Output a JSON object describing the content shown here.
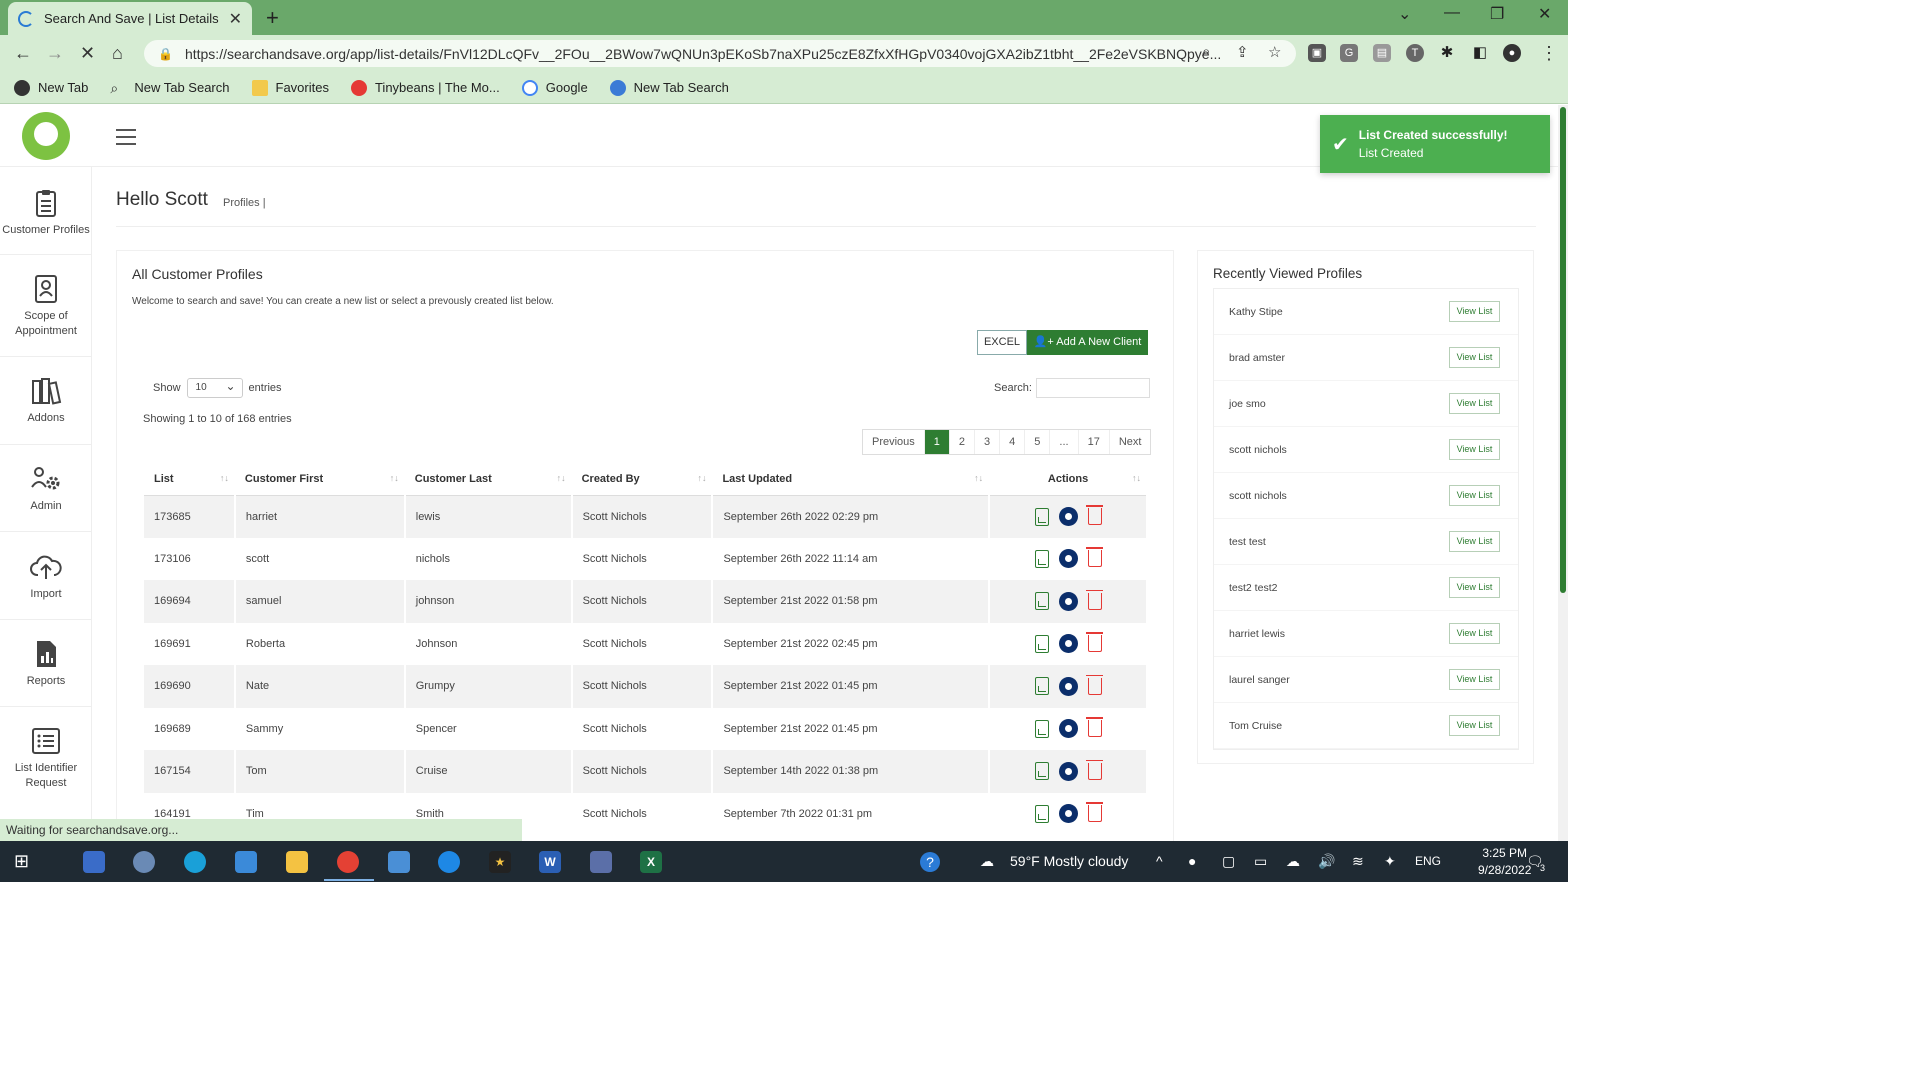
{
  "browser": {
    "tab_title": "Search And Save | List Details",
    "url": "https://searchandsave.org/app/list-details/FnVl12DLcQFv__2FOu__2BWow7wQNUn3pEKoSb7naXPu25czE8ZfxXfHGpV0340vojGXA2ibZ1tbht__2Fe2eVSKBNQpye...",
    "bookmarks": [
      "New Tab",
      "New Tab Search",
      "Favorites",
      "Tinybeans | The Mo...",
      "Google",
      "New Tab Search"
    ],
    "status_text": "Waiting for searchandsave.org..."
  },
  "toast": {
    "title": "List Created successfully!",
    "message": "List Created"
  },
  "sidebar": {
    "items": [
      {
        "label": "Customer Profiles",
        "icon": "clipboard-icon"
      },
      {
        "label": "Scope of Appointment",
        "icon": "id-card-icon"
      },
      {
        "label": "Addons",
        "icon": "books-icon"
      },
      {
        "label": "Admin",
        "icon": "users-gear-icon"
      },
      {
        "label": "Import",
        "icon": "cloud-upload-icon"
      },
      {
        "label": "Reports",
        "icon": "report-chart-icon"
      },
      {
        "label": "List Identifier Request",
        "icon": "list-icon"
      }
    ]
  },
  "header": {
    "greeting": "Hello Scott",
    "breadcrumb": "Profiles |"
  },
  "main": {
    "title": "All Customer Profiles",
    "welcome": "Welcome to search and save! You can create a new list or select a prevously created list below.",
    "excel_label": "EXCEL",
    "add_label": "Add A New Client",
    "show_label": "Show",
    "entries_value": "10",
    "entries_label": "entries",
    "search_label": "Search:",
    "info": "Showing 1 to 10 of 168 entries",
    "pager": [
      "Previous",
      "1",
      "2",
      "3",
      "4",
      "5",
      "...",
      "17",
      "Next"
    ],
    "columns": [
      "List",
      "Customer First",
      "Customer Last",
      "Created By",
      "Last Updated",
      "Actions"
    ],
    "rows": [
      [
        "173685",
        "harriet",
        "lewis",
        "Scott Nichols",
        "September 26th 2022 02:29 pm"
      ],
      [
        "173106",
        "scott",
        "nichols",
        "Scott Nichols",
        "September 26th 2022 11:14 am"
      ],
      [
        "169694",
        "samuel",
        "johnson",
        "Scott Nichols",
        "September 21st 2022 01:58 pm"
      ],
      [
        "169691",
        "Roberta",
        "Johnson",
        "Scott Nichols",
        "September 21st 2022 02:45 pm"
      ],
      [
        "169690",
        "Nate",
        "Grumpy",
        "Scott Nichols",
        "September 21st 2022 01:45 pm"
      ],
      [
        "169689",
        "Sammy",
        "Spencer",
        "Scott Nichols",
        "September 21st 2022 01:45 pm"
      ],
      [
        "167154",
        "Tom",
        "Cruise",
        "Scott Nichols",
        "September 14th 2022 01:38 pm"
      ],
      [
        "164191",
        "Tim",
        "Smith",
        "Scott Nichols",
        "September 7th 2022 01:31 pm"
      ]
    ]
  },
  "recent": {
    "title": "Recently Viewed Profiles",
    "button_label": "View List",
    "names": [
      "Kathy Stipe",
      "brad amster",
      "joe smo",
      "scott nichols",
      "scott nichols",
      "test test",
      "test2 test2",
      "harriet lewis",
      "laurel sanger",
      "Tom Cruise"
    ]
  },
  "taskbar": {
    "weather": "59°F  Mostly cloudy",
    "lang": "ENG",
    "time": "3:25 PM",
    "date": "9/28/2022",
    "notif_count": "3"
  },
  "colors": {
    "brand_green": "#2e7d32",
    "toast_green": "#4caf50",
    "chrome_green": "#6aa86a"
  }
}
